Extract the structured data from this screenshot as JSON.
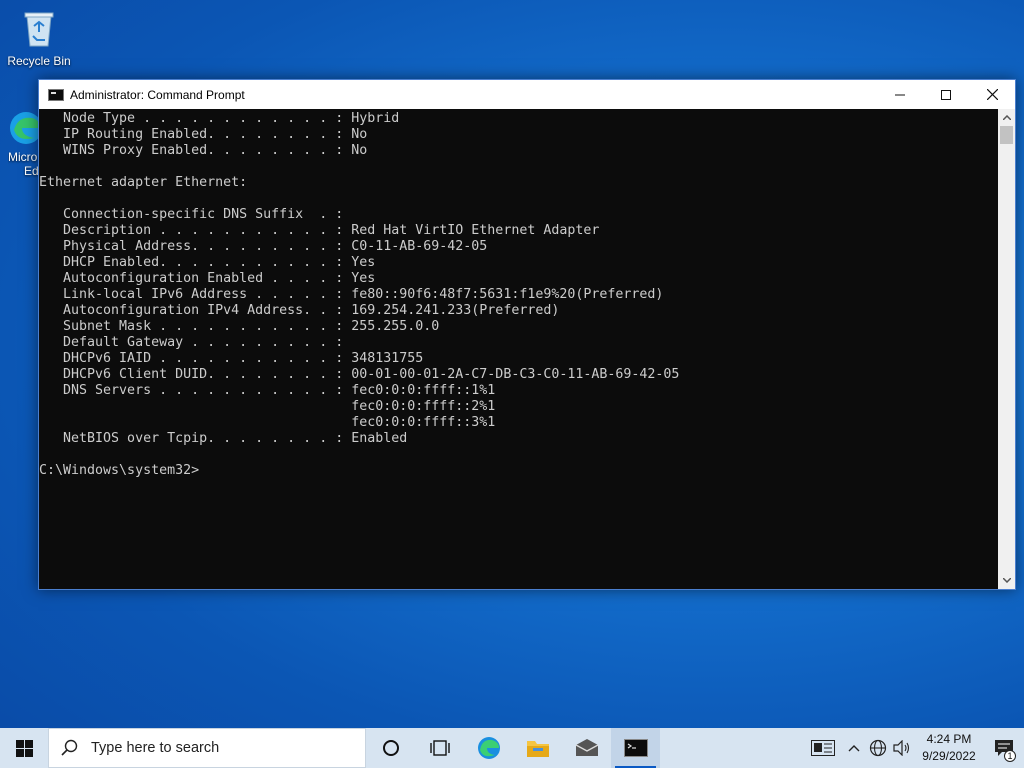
{
  "desktop": {
    "recycle_bin_label": "Recycle Bin",
    "edge_label_line1": "Micro",
    "edge_label_line2": "Ed"
  },
  "window": {
    "title": "Administrator: Command Prompt"
  },
  "console_lines": [
    "   Node Type . . . . . . . . . . . . : Hybrid",
    "   IP Routing Enabled. . . . . . . . : No",
    "   WINS Proxy Enabled. . . . . . . . : No",
    "",
    "Ethernet adapter Ethernet:",
    "",
    "   Connection-specific DNS Suffix  . :",
    "   Description . . . . . . . . . . . : Red Hat VirtIO Ethernet Adapter",
    "   Physical Address. . . . . . . . . : C0-11-AB-69-42-05",
    "   DHCP Enabled. . . . . . . . . . . : Yes",
    "   Autoconfiguration Enabled . . . . : Yes",
    "   Link-local IPv6 Address . . . . . : fe80::90f6:48f7:5631:f1e9%20(Preferred)",
    "   Autoconfiguration IPv4 Address. . : 169.254.241.233(Preferred)",
    "   Subnet Mask . . . . . . . . . . . : 255.255.0.0",
    "   Default Gateway . . . . . . . . . :",
    "   DHCPv6 IAID . . . . . . . . . . . : 348131755",
    "   DHCPv6 Client DUID. . . . . . . . : 00-01-00-01-2A-C7-DB-C3-C0-11-AB-69-42-05",
    "   DNS Servers . . . . . . . . . . . : fec0:0:0:ffff::1%1",
    "                                       fec0:0:0:ffff::2%1",
    "                                       fec0:0:0:ffff::3%1",
    "   NetBIOS over Tcpip. . . . . . . . : Enabled",
    "",
    "C:\\Windows\\system32>"
  ],
  "taskbar": {
    "search_placeholder": "Type here to search",
    "time": "4:24 PM",
    "date": "9/29/2022",
    "notification_count": "1",
    "accent": "#0a59c4"
  }
}
